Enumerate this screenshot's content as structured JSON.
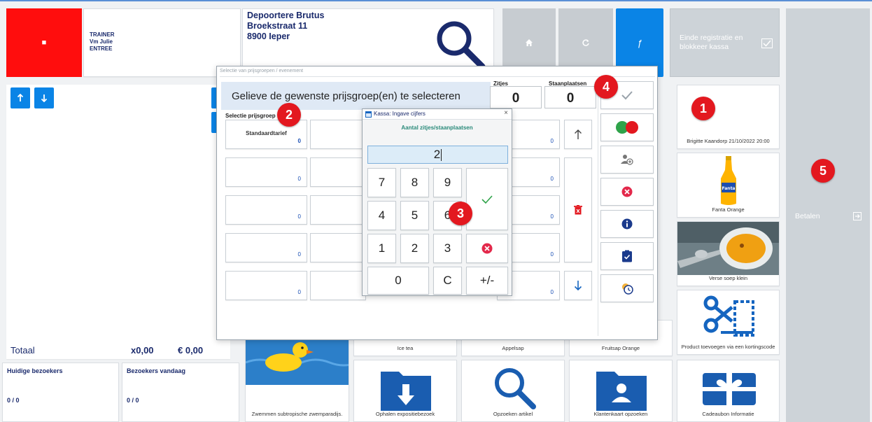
{
  "header": {
    "stop_symbol": "■",
    "trainer": "TRAINER",
    "user": "Vm Julie",
    "entry": "ENTREE",
    "customer_name": "Depoortere  Brutus",
    "customer_street": "Broekstraat 11",
    "customer_city": "8900 Ieper",
    "end_registration": "Einde registratie en blokkeer kassa",
    "home_icon": "home-icon",
    "refresh_icon": "refresh-icon",
    "function_label": "ƒ"
  },
  "left": {
    "total_label": "Totaal",
    "total_qty": "x0,00",
    "total_amount": "€ 0,00",
    "current_visitors_label": "Huidige bezoekers",
    "current_visitors_value": "0 / 0",
    "today_visitors_label": "Bezoekers vandaag",
    "today_visitors_value": "0 / 0"
  },
  "pay": {
    "label": "Betalen"
  },
  "products": [
    {
      "label": "Brigitte Kaandorp 21/10/2022 20:00"
    },
    {
      "label": "Fanta Orange"
    },
    {
      "label": "Verse soep klein"
    },
    {
      "label": "Product toevoegen via een kortingscode"
    },
    {
      "label": "Ice tea"
    },
    {
      "label": "Appelsap"
    },
    {
      "label": "Fruitsap Orange"
    },
    {
      "label": "Zwemmen subtropische zwemparadijs."
    },
    {
      "label": "Ophalen expositiebezoek"
    },
    {
      "label": "Opzoeken artikel"
    },
    {
      "label": "Klantenkaart opzoeken"
    },
    {
      "label": "Cadeaubon Informatie"
    }
  ],
  "dialog": {
    "title": "Selectie van prijsgroepen / evenement",
    "instruction": "Gelieve de gewenste prijsgroep(en) te selecteren",
    "zitjes_label": "Zitjes",
    "zitjes_value": "0",
    "staan_label": "Staanplaatsen",
    "staan_value": "0",
    "selection_label": "Selectie prijsgroep",
    "standard_tariff": "Standaardtarief",
    "zero": "0"
  },
  "numpad": {
    "title": "Kassa: Ingave cijfers",
    "subtitle": "Aantal zitjes/staanplaatsen",
    "value": "2",
    "close": "×",
    "keys": [
      "7",
      "8",
      "9",
      "4",
      "5",
      "6",
      "1",
      "2",
      "3",
      "0",
      "C",
      "+/-"
    ]
  },
  "badges": [
    "1",
    "2",
    "3",
    "4",
    "5"
  ],
  "colors": {
    "red": "#ff0d0d",
    "blue": "#0a84e6",
    "navy": "#1a2a6c",
    "badge": "#e3181f"
  }
}
